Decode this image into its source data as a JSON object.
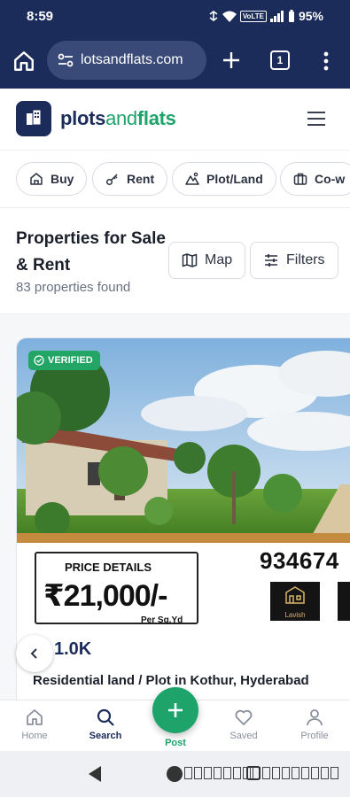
{
  "status_bar": {
    "time": "8:59",
    "network": "VoLTE",
    "battery": "95%"
  },
  "browser": {
    "url": "lotsandflats.com",
    "tab_count": "1"
  },
  "header": {
    "brand_part1": "plots",
    "brand_part2": "and",
    "brand_part3": "flats"
  },
  "categories": [
    {
      "label": "Buy",
      "icon": "home-icon"
    },
    {
      "label": "Rent",
      "icon": "key-icon"
    },
    {
      "label": "Plot/Land",
      "icon": "land-icon"
    },
    {
      "label": "Co-w",
      "icon": "briefcase-icon"
    }
  ],
  "listing_header": {
    "title": "Properties for Sale & Rent",
    "count": "83 properties found",
    "map_label": "Map",
    "filters_label": "Filters"
  },
  "card": {
    "badge": "VERIFIED",
    "banner_price_heading": "PRICE DETAILS",
    "banner_price": "₹21,000/-",
    "banner_unit": "Per Sq.Yd",
    "banner_phone": "934674",
    "banner_logo_text": "Lavish",
    "price": "1.0K",
    "title": "Residential land / Plot in Kothur, Hyderabad"
  },
  "bottom_nav": {
    "home": "Home",
    "search": "Search",
    "post": "Post",
    "saved": "Saved",
    "profile": "Profile"
  },
  "colors": {
    "primary": "#1b2c5a",
    "accent": "#1ea36b",
    "verified": "#22a565"
  }
}
